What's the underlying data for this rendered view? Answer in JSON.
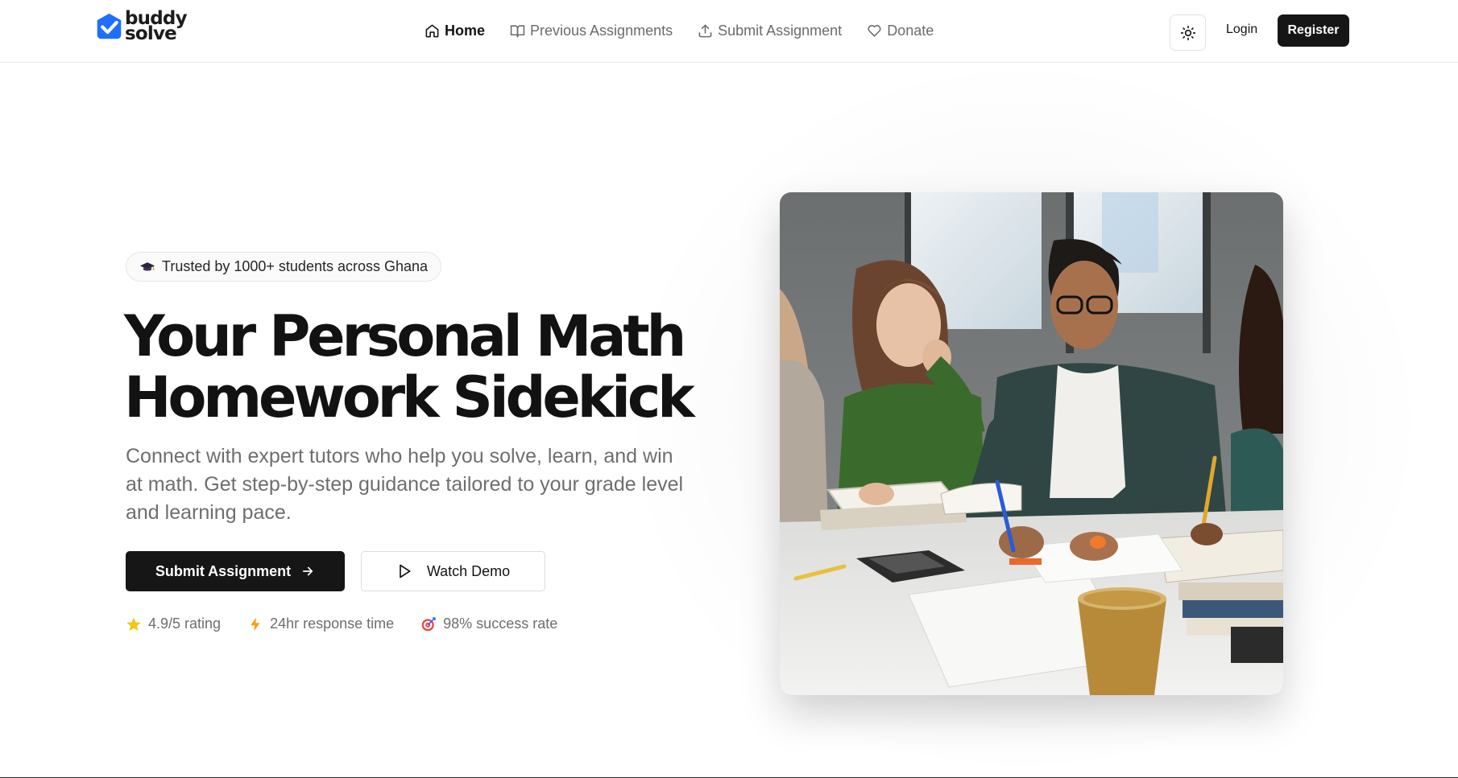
{
  "brand": {
    "line1": "buddy",
    "line2": "solve",
    "accent_color": "#1f6fff"
  },
  "nav": {
    "items": [
      {
        "label": "Home",
        "icon": "home-icon",
        "active": true
      },
      {
        "label": "Previous Assignments",
        "icon": "book-icon",
        "active": false
      },
      {
        "label": "Submit Assignment",
        "icon": "upload-icon",
        "active": false
      },
      {
        "label": "Donate",
        "icon": "heart-icon",
        "active": false
      }
    ],
    "theme_toggle_icon": "sun-icon",
    "login_label": "Login",
    "register_label": "Register"
  },
  "hero": {
    "badge": "Trusted by 1000+ students across Ghana",
    "headline_line1": "Your Personal Math",
    "headline_line2": "Homework Sidekick",
    "subtext": "Connect with expert tutors who help you solve, learn, and win at math. Get step-by-step guidance tailored to your grade level and learning pace.",
    "primary_cta": "Submit Assignment",
    "secondary_cta": "Watch Demo",
    "stats": [
      {
        "icon": "star-icon",
        "label": "4.9/5 rating"
      },
      {
        "icon": "lightning-icon",
        "label": "24hr response time"
      },
      {
        "icon": "target-icon",
        "label": "98% success rate"
      }
    ]
  },
  "colors": {
    "primary_button": "#161616",
    "text_muted": "#6e6e6e"
  }
}
